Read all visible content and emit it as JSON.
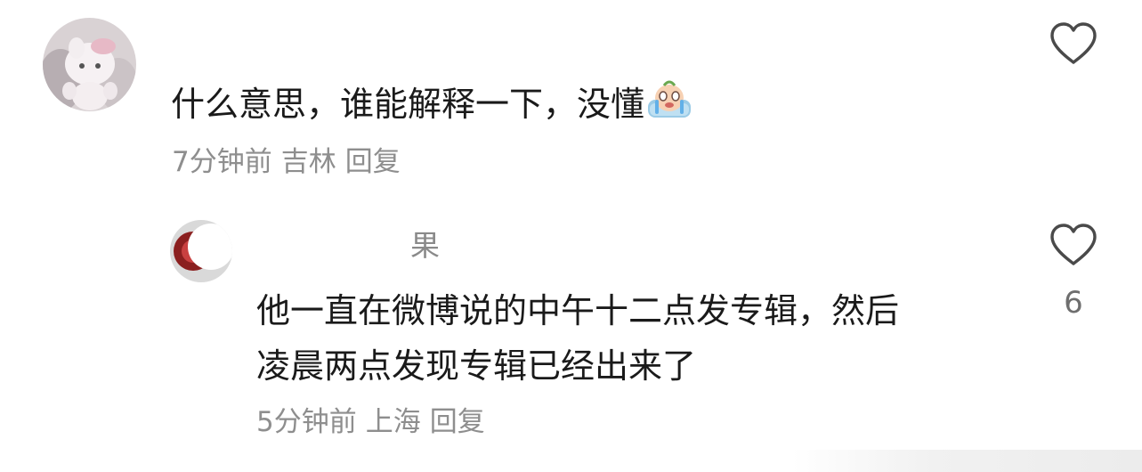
{
  "comments": [
    {
      "text": "什么意思，谁能解释一下，没懂",
      "emoji": "crying-face-emoji",
      "time": "7分钟前",
      "location": "吉林",
      "reply_label": "回复"
    }
  ],
  "reply": {
    "username": "果",
    "text_line1": "他一直在微博说的中午十二点发专辑，然后",
    "text_line2": "凌晨两点发现专辑已经出来了",
    "time": "5分钟前",
    "location": "上海",
    "reply_label": "回复",
    "like_count": "6"
  },
  "icons": {
    "like": "heart-outline-icon"
  }
}
